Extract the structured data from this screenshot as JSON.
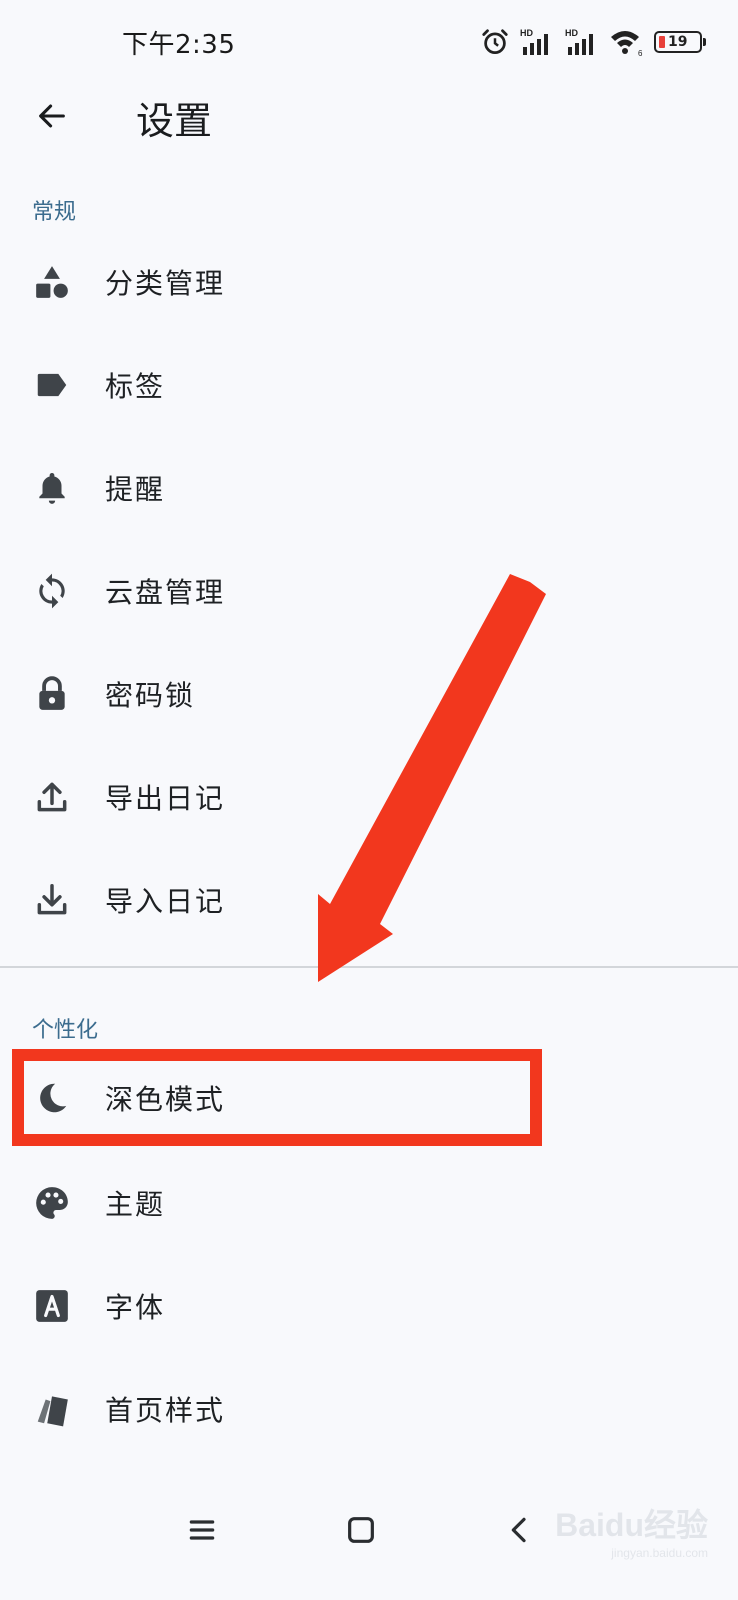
{
  "status_bar": {
    "time": "下午2:35",
    "battery_level": "19",
    "signal_label_1": "HD",
    "signal_label_2": "HD",
    "wifi_sub": "6"
  },
  "header": {
    "title": "设置"
  },
  "sections": [
    {
      "title": "常规",
      "items": [
        {
          "label": "分类管理",
          "icon": "shapes-icon"
        },
        {
          "label": "标签",
          "icon": "label-icon"
        },
        {
          "label": "提醒",
          "icon": "bell-icon"
        },
        {
          "label": "云盘管理",
          "icon": "sync-icon"
        },
        {
          "label": "密码锁",
          "icon": "lock-icon"
        },
        {
          "label": "导出日记",
          "icon": "upload-icon"
        },
        {
          "label": "导入日记",
          "icon": "download-icon"
        }
      ]
    },
    {
      "title": "个性化",
      "items": [
        {
          "label": "深色模式",
          "icon": "moon-icon"
        },
        {
          "label": "主题",
          "icon": "palette-icon"
        },
        {
          "label": "字体",
          "icon": "font-icon"
        },
        {
          "label": "首页样式",
          "icon": "cards-icon"
        }
      ]
    }
  ],
  "watermark": {
    "text": "Baidu经验",
    "sub": "jingyan.baidu.com"
  },
  "colors": {
    "background": "#f8f9fc",
    "section_header": "#3b6c8e",
    "icon": "#3f4449",
    "annotation": "#f2371e"
  }
}
